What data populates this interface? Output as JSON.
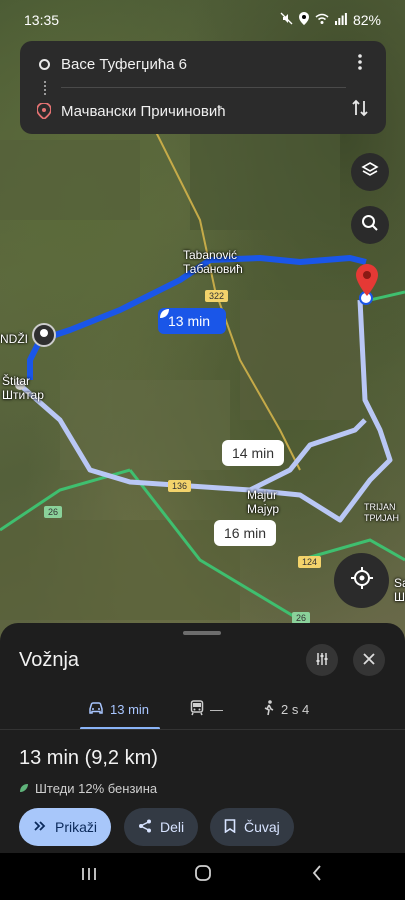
{
  "status_bar": {
    "time": "13:35",
    "battery": "82%"
  },
  "route": {
    "origin": "Васе Туфегџића 6",
    "destination": "Мачвански Причиновић"
  },
  "map": {
    "labels": {
      "tabanovic_lat": "Tabanović",
      "tabanovic_cyr": "Табановић",
      "stitar_lat": "Štitar",
      "stitar_cyr": "Штитар",
      "majur_lat": "Majur",
      "majur_cyr": "Мајур",
      "ndzi": "NDŽI",
      "trijan_lat": "TRIJAN",
      "trijan_cyr": "ТРИЈАН",
      "sa": "Sa",
      "sha": "Ша"
    },
    "road_numbers": [
      "322",
      "136",
      "26",
      "124",
      "26"
    ],
    "route_times": {
      "primary": "13 min",
      "alt1": "14 min",
      "alt2": "16 min"
    },
    "colors": {
      "primary_route": "#1a56e8",
      "alt_route": "#b9c7f5",
      "destination_pin": "#e53935"
    }
  },
  "sheet": {
    "title": "Vožnja",
    "modes": [
      {
        "icon": "car-icon",
        "label": "13 min"
      },
      {
        "icon": "transit-icon",
        "label": "—"
      },
      {
        "icon": "walk-icon",
        "label": "2 s 4"
      }
    ],
    "summary": "13 min (9,2 km)",
    "eco_note": "Штеди 12% бензина",
    "buttons": {
      "show": "Prikaži",
      "share": "Deli",
      "save": "Čuvaj"
    }
  }
}
